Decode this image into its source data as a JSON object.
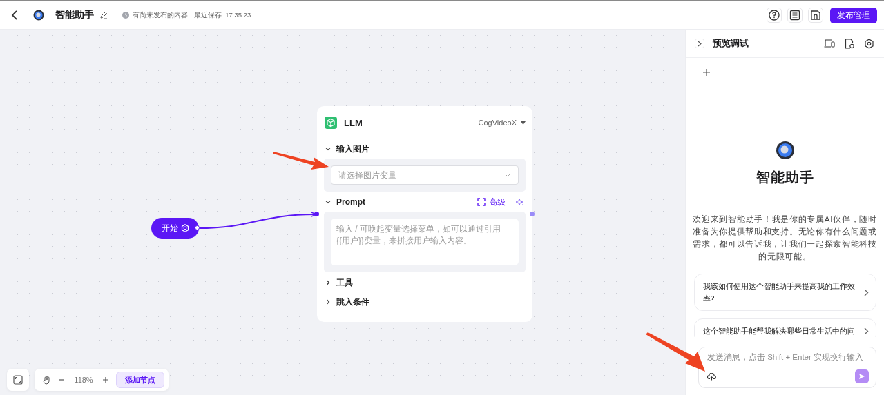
{
  "header": {
    "title": "智能助手",
    "status": "有尚未发布的内容",
    "saved": "最近保存: 17:35:23",
    "publish_button": "发布管理"
  },
  "canvas": {
    "start_node": {
      "label": "开始"
    },
    "llm_node": {
      "title": "LLM",
      "model": "CogVideoX",
      "sections": [
        {
          "kind": "image",
          "title": "输入图片",
          "expanded": true,
          "placeholder": "请选择图片变量"
        },
        {
          "kind": "prompt",
          "title": "Prompt",
          "expanded": true,
          "advanced": "高级",
          "placeholder": "输入 / 可唤起变量选择菜单，如可以通过引用{{用户}}变量，来拼接用户输入内容。"
        },
        {
          "kind": "plain",
          "title": "工具",
          "expanded": false
        },
        {
          "kind": "plain",
          "title": "跳入条件",
          "expanded": false
        }
      ]
    },
    "toolbar": {
      "zoom": "118%",
      "add_node": "添加节点"
    }
  },
  "preview": {
    "title": "预览调试",
    "assistant_name": "智能助手",
    "welcome": "欢迎来到智能助手！我是你的专属AI伙伴，随时准备为你提供帮助和支持。无论你有什么问题或需求，都可以告诉我，让我们一起探索智能科技的无限可能。",
    "suggestions": [
      "我该如何使用这个智能助手来提高我的工作效率?",
      "这个智能助手能帮我解决哪些日常生活中的问"
    ],
    "input_placeholder": "发送消息，点击 Shift + Enter 实现换行输入"
  }
}
